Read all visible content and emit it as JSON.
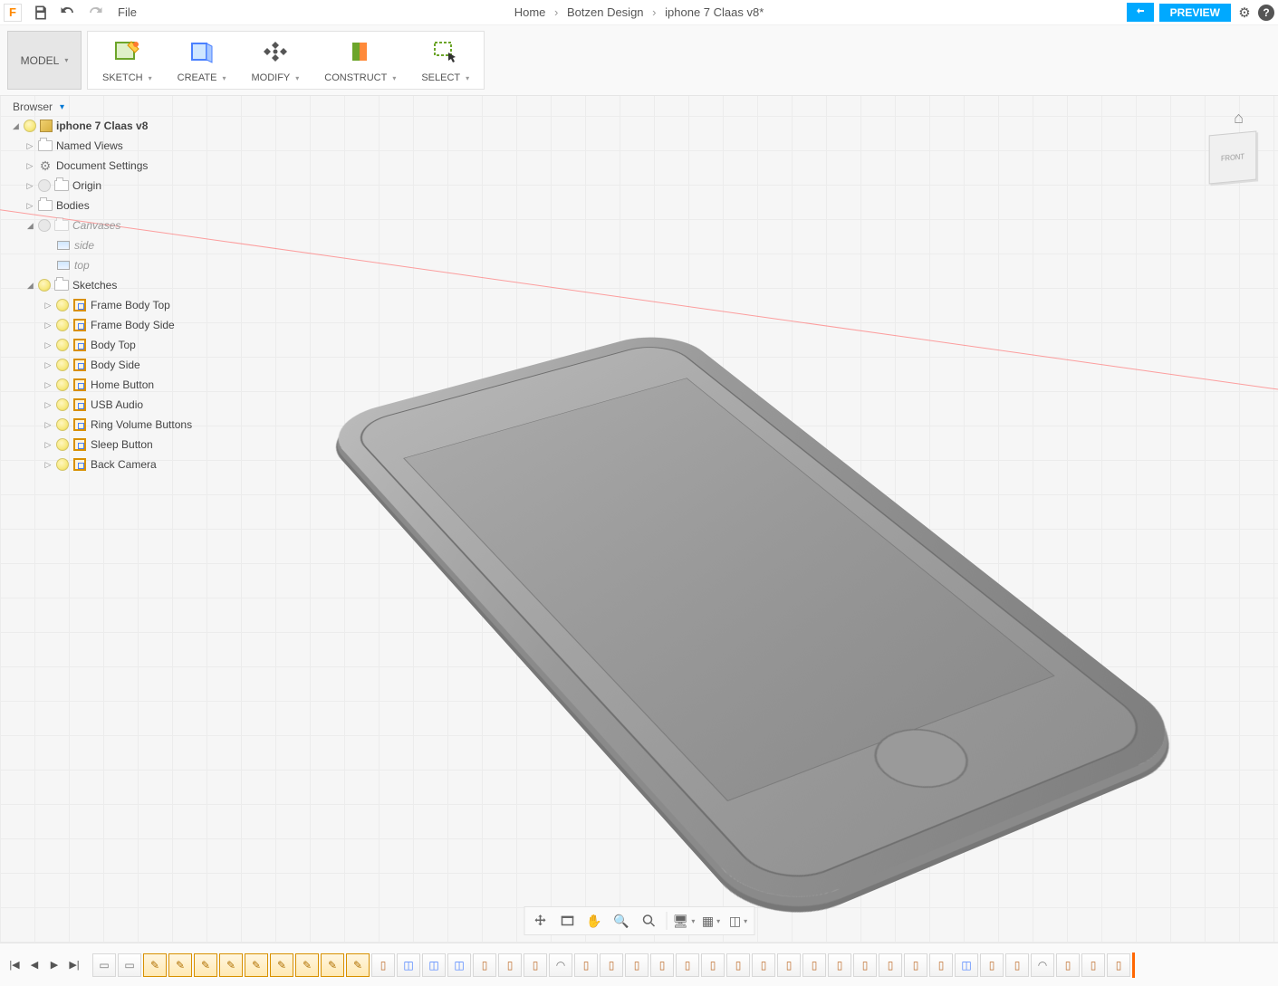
{
  "title": {
    "appInitial": "F",
    "fileMenu": "File",
    "breadcrumb": {
      "home": "Home",
      "folder": "Botzen Design",
      "file": "iphone 7 Claas v8*"
    },
    "preview": "PREVIEW"
  },
  "ribbon": {
    "mode": "MODEL",
    "items": [
      {
        "label": "SKETCH"
      },
      {
        "label": "CREATE"
      },
      {
        "label": "MODIFY"
      },
      {
        "label": "CONSTRUCT"
      },
      {
        "label": "SELECT"
      }
    ]
  },
  "browserTitle": "Browser",
  "viewcube": "FRONT",
  "tree": {
    "root": "iphone 7 Claas v8",
    "namedViews": "Named Views",
    "docSettings": "Document Settings",
    "origin": "Origin",
    "bodies": "Bodies",
    "canvases": "Canvases",
    "canvasItems": [
      "side",
      "top"
    ],
    "sketchesLabel": "Sketches",
    "sketches": [
      "Frame Body Top",
      "Frame Body Side",
      "Body Top",
      "Body Side",
      "Home Button",
      "USB Audio",
      "Ring Volume Buttons",
      "Sleep Button",
      "Back Camera"
    ]
  }
}
